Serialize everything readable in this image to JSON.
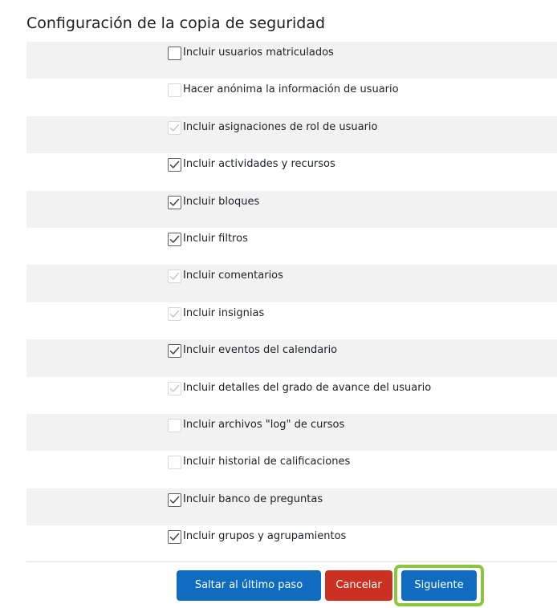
{
  "page": {
    "title": "Configuración de la copia de seguridad"
  },
  "settings": [
    {
      "label": "Incluir usuarios matriculados",
      "checked": false,
      "disabled": false
    },
    {
      "label": "Hacer anónima la información de usuario",
      "checked": false,
      "disabled": true
    },
    {
      "label": "Incluir asignaciones de rol de usuario",
      "checked": true,
      "disabled": true
    },
    {
      "label": "Incluir actividades y recursos",
      "checked": true,
      "disabled": false
    },
    {
      "label": "Incluir bloques",
      "checked": true,
      "disabled": false
    },
    {
      "label": "Incluir filtros",
      "checked": true,
      "disabled": false
    },
    {
      "label": "Incluir comentarios",
      "checked": true,
      "disabled": true
    },
    {
      "label": "Incluir insignias",
      "checked": true,
      "disabled": true
    },
    {
      "label": "Incluir eventos del calendario",
      "checked": true,
      "disabled": false
    },
    {
      "label": "Incluir detalles del grado de avance del usuario",
      "checked": true,
      "disabled": true
    },
    {
      "label": "Incluir archivos \"log\" de cursos",
      "checked": false,
      "disabled": true
    },
    {
      "label": "Incluir historial de calificaciones",
      "checked": false,
      "disabled": true
    },
    {
      "label": "Incluir banco de preguntas",
      "checked": true,
      "disabled": false
    },
    {
      "label": "Incluir grupos y agrupamientos",
      "checked": true,
      "disabled": false
    }
  ],
  "actions": {
    "skip_label": "Saltar al último paso",
    "cancel_label": "Cancelar",
    "next_label": "Siguiente"
  },
  "colors": {
    "primary": "#0f6cbf",
    "danger": "#ca3120",
    "highlight": "#8cc63f",
    "stripe": "#f2f2f2",
    "check_enabled": "#3a3a3a",
    "check_disabled": "#c4c4c4"
  },
  "icons": {
    "checked": "checkmark-icon"
  }
}
